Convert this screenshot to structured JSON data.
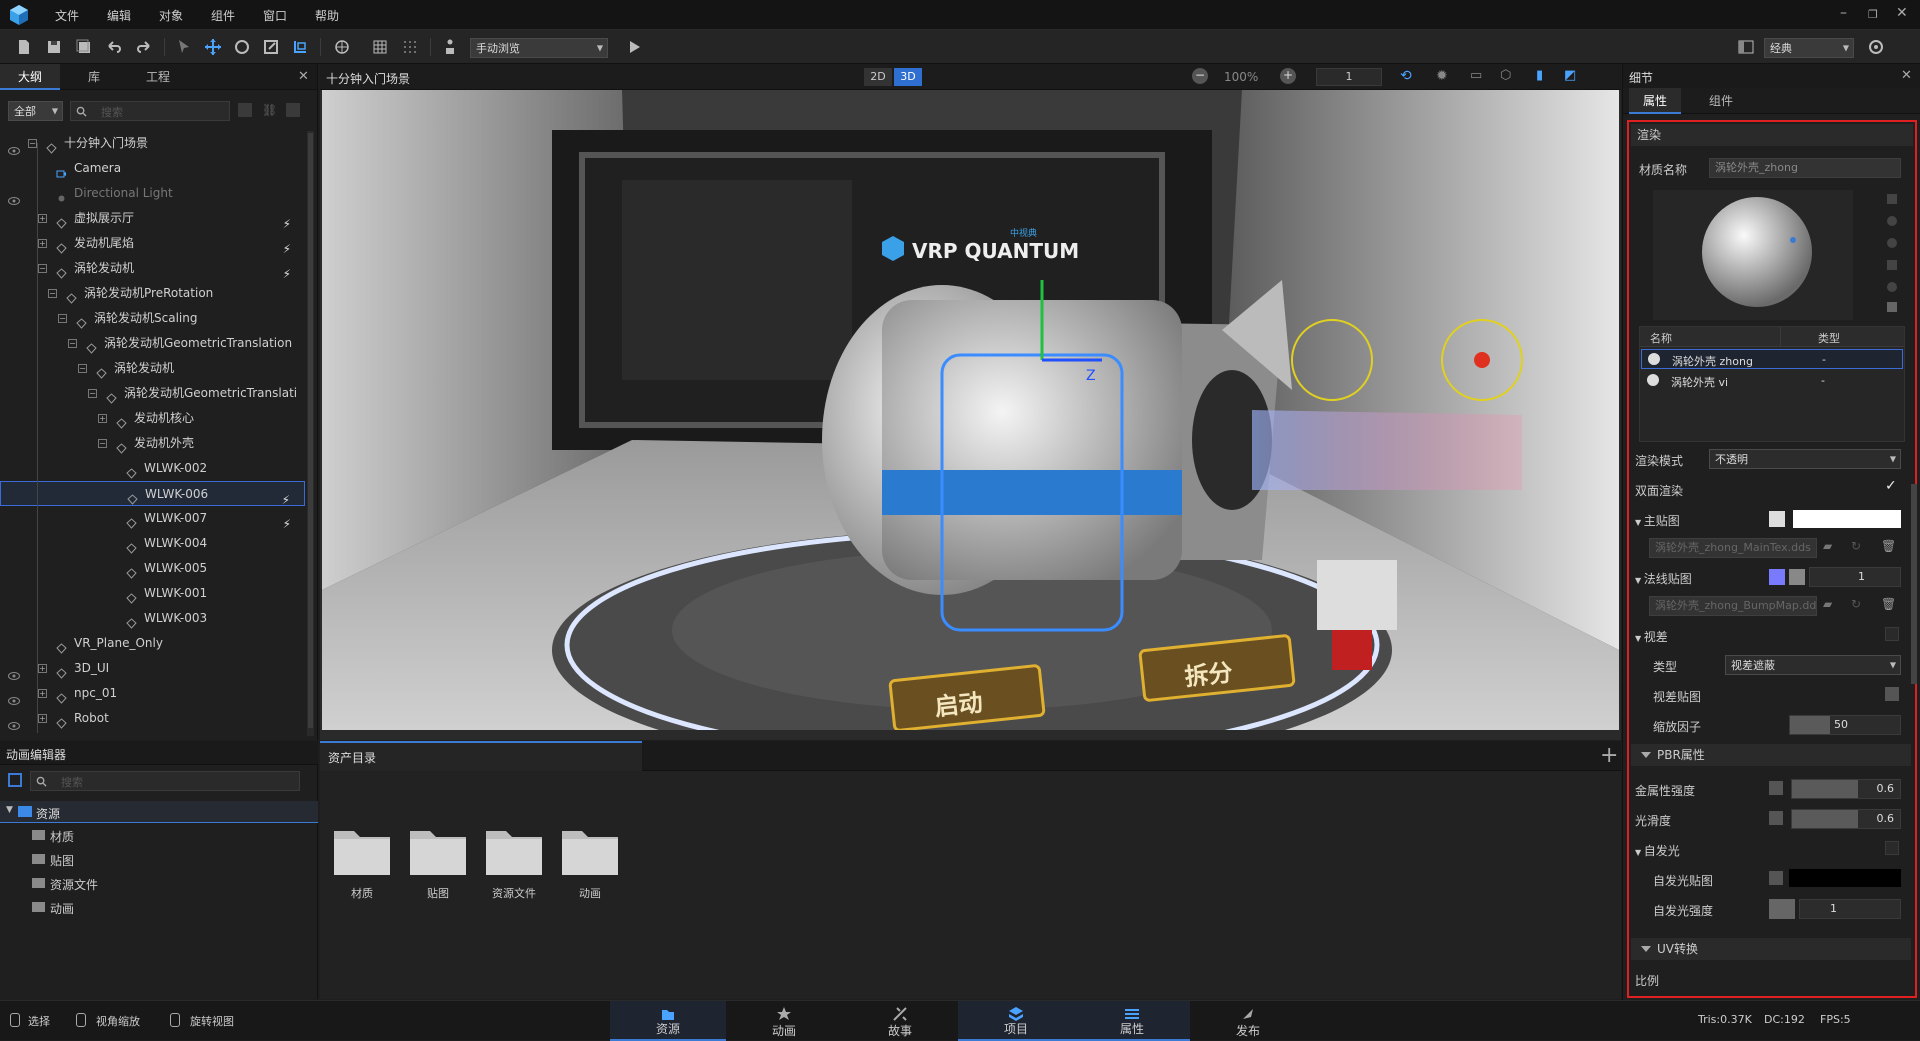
{
  "menu": {
    "items": [
      "文件",
      "编辑",
      "对象",
      "组件",
      "窗口",
      "帮助"
    ]
  },
  "toolbar": {
    "view_mode": "手动浏览",
    "layout": "经典"
  },
  "left_panel": {
    "tabs": [
      "大纲",
      "库",
      "工程"
    ],
    "filter": "全部",
    "search_placeholder": "搜索",
    "tree": [
      {
        "label": "十分钟入门场景"
      },
      {
        "label": "Camera"
      },
      {
        "label": "Directional Light"
      },
      {
        "label": "虚拟展示厅"
      },
      {
        "label": "发动机尾焰"
      },
      {
        "label": "涡轮发动机"
      },
      {
        "label": "涡轮发动机PreRotation"
      },
      {
        "label": "涡轮发动机Scaling"
      },
      {
        "label": "涡轮发动机GeometricTranslation"
      },
      {
        "label": "涡轮发动机"
      },
      {
        "label": "涡轮发动机GeometricTranslati"
      },
      {
        "label": "发动机核心"
      },
      {
        "label": "发动机外壳"
      },
      {
        "label": "WLWK-002"
      },
      {
        "label": "WLWK-006"
      },
      {
        "label": "WLWK-007"
      },
      {
        "label": "WLWK-004"
      },
      {
        "label": "WLWK-005"
      },
      {
        "label": "WLWK-001"
      },
      {
        "label": "WLWK-003"
      },
      {
        "label": "VR_Plane_Only"
      },
      {
        "label": "3D_UI"
      },
      {
        "label": "npc_01"
      },
      {
        "label": "Robot"
      }
    ]
  },
  "viewport": {
    "title": "十分钟入门场景",
    "mode_2d": "2D",
    "mode_3d": "3D",
    "zoom": "100%",
    "speed": "1",
    "scene_text": {
      "brand": "VRP QUANTUM",
      "brand_sub": "中视典",
      "start_btn": "启动",
      "split_btn": "拆分",
      "axis_z": "Z"
    }
  },
  "right_panel": {
    "title": "细节",
    "tabs": [
      "属性",
      "组件"
    ],
    "section_render": "渲染",
    "material_name_label": "材质名称",
    "material_name_value": "涡轮外壳_zhong",
    "table_headers": [
      "名称",
      "类型"
    ],
    "materials": [
      {
        "name": "涡轮外壳 zhong",
        "type": "-"
      },
      {
        "name": "涡轮外壳 vi",
        "type": "-"
      }
    ],
    "render_mode_label": "渲染模式",
    "render_mode_value": "不透明",
    "double_sided_label": "双面渲染",
    "main_tex_label": "主贴图",
    "main_tex_file": "涡轮外壳_zhong_MainTex.dds",
    "normal_tex_label": "法线贴图",
    "normal_value": "1",
    "normal_tex_file": "涡轮外壳_zhong_BumpMap.dds",
    "parallax_label": "视差",
    "type_label": "类型",
    "type_value": "视差遮蔽",
    "parallax_map_label": "视差贴图",
    "scale_factor_label": "缩放因子",
    "scale_factor_value": "50",
    "section_pbr": "PBR属性",
    "metal_label": "金属性强度",
    "metal_value": "0.6",
    "smooth_label": "光滑度",
    "smooth_value": "0.6",
    "emissive_label": "自发光",
    "emissive_map_label": "自发光贴图",
    "emissive_strength_label": "自发光强度",
    "emissive_strength_value": "1",
    "section_uv": "UV转换",
    "ratio_label": "比例"
  },
  "anim_panel": {
    "title": "动画编辑器",
    "search_placeholder": "搜索",
    "root": "资源",
    "children": [
      "材质",
      "贴图",
      "资源文件",
      "动画"
    ]
  },
  "asset_panel": {
    "title": "资产目录",
    "folders": [
      "材质",
      "贴图",
      "资源文件",
      "动画"
    ]
  },
  "status": {
    "left": [
      "选择",
      "视角缩放",
      "旋转视图"
    ],
    "tabs": [
      "资源",
      "动画",
      "故事",
      "项目",
      "属性",
      "发布"
    ],
    "tris": "Tris:0.37K",
    "dc": "DC:192",
    "fps": "FPS:5"
  },
  "colors": {
    "accent": "#3b7bd6",
    "highlight": "#e02020"
  }
}
